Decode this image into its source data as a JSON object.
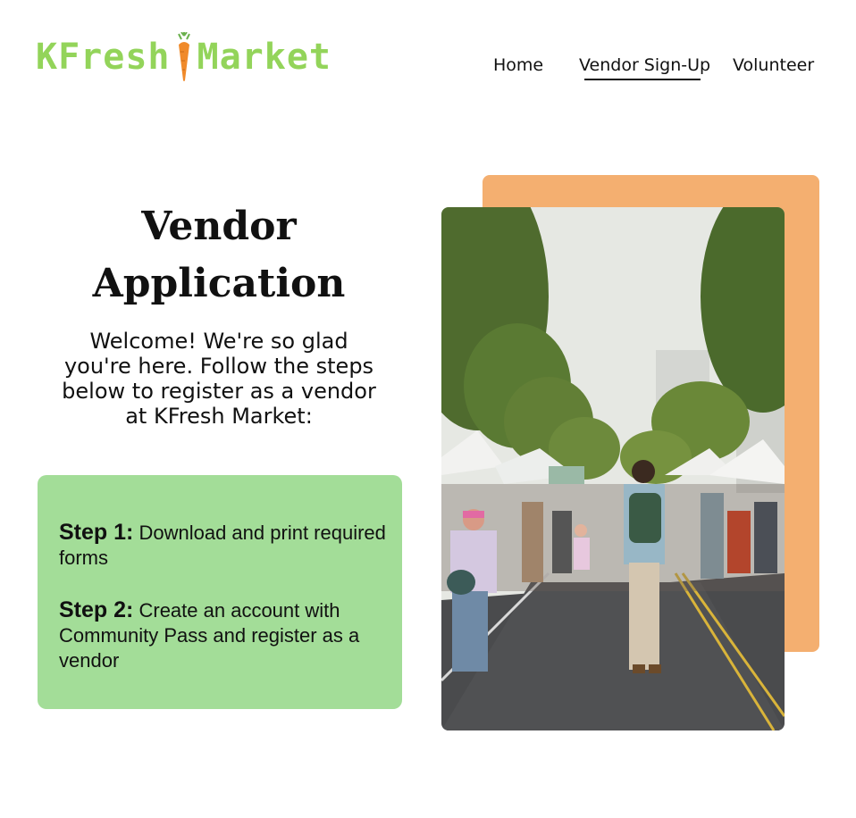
{
  "header": {
    "logo": {
      "text_left": "KFresh",
      "text_right": "Market"
    },
    "nav": [
      {
        "label": "Home"
      },
      {
        "label": "Vendor Sign-Up"
      },
      {
        "label": "Volunteer"
      }
    ]
  },
  "hero": {
    "title_line1": "Vendor",
    "title_line2": "Application",
    "welcome_line1": "Welcome! We're so glad",
    "welcome_line2": "you're here.  Follow the steps",
    "welcome_line3": "below to register as a vendor",
    "welcome_line4": "at KFresh Market:"
  },
  "steps": [
    {
      "label": "Step 1:",
      "text": "Download and print required forms"
    },
    {
      "label": "Step 2:",
      "text": "Create an account with Community Pass and register as a vendor"
    }
  ],
  "colors": {
    "logo_green": "#93d45a",
    "card_green": "#a3dd98",
    "accent_orange": "#f4af70",
    "carrot_orange": "#f08a2a"
  },
  "image": {
    "icon": "market-street-photo"
  }
}
